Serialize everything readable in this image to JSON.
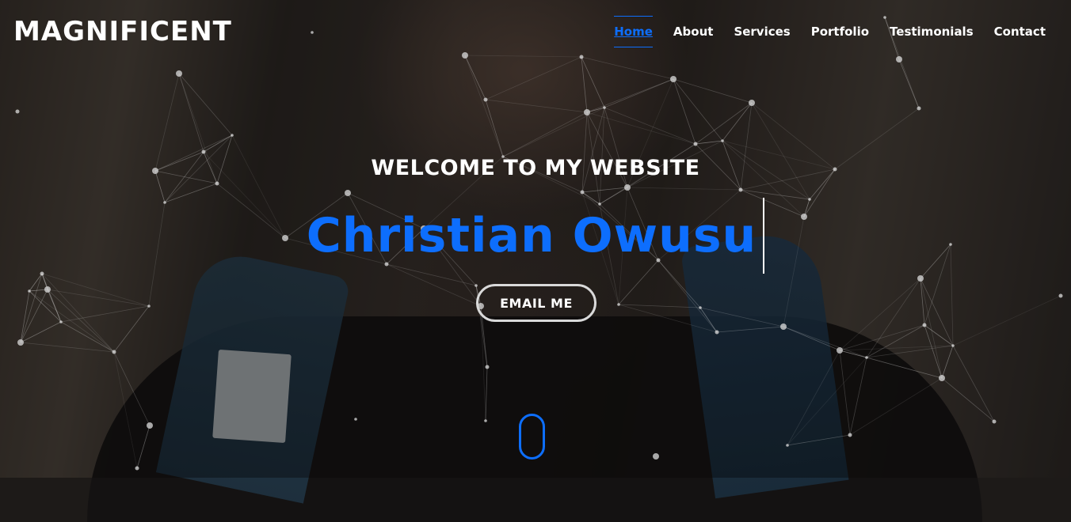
{
  "header": {
    "logo": "MAGNIFICENT",
    "nav": [
      {
        "label": "Home",
        "active": true
      },
      {
        "label": "About"
      },
      {
        "label": "Services"
      },
      {
        "label": "Portfolio"
      },
      {
        "label": "Testimonials"
      },
      {
        "label": "Contact"
      }
    ]
  },
  "hero": {
    "welcome": "WELCOME TO MY WEBSITE",
    "name": "Christian Owusu",
    "email_button": "EMAIL ME"
  },
  "colors": {
    "accent": "#0d6efd",
    "text": "#ffffff",
    "button_border": "#d9d9d9"
  },
  "icons": [
    "scroll-down-icon"
  ]
}
